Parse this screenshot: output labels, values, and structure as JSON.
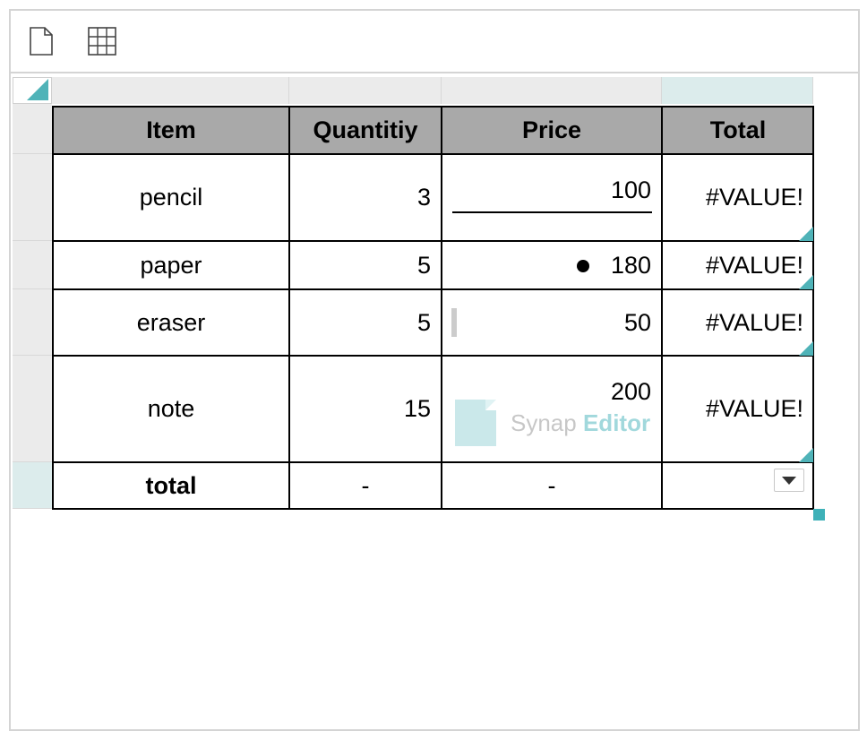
{
  "toolbar": {
    "new_doc_icon": "page-icon",
    "table_icon": "table-grid-icon"
  },
  "table": {
    "headers": [
      "Item",
      "Quantitiy",
      "Price",
      "Total"
    ],
    "rows": [
      {
        "item": "pencil",
        "qty": "3",
        "price": "100",
        "total": "#VALUE!"
      },
      {
        "item": "paper",
        "qty": "5",
        "price": "180",
        "total": "#VALUE!"
      },
      {
        "item": "eraser",
        "qty": "5",
        "price": "50",
        "total": "#VALUE!"
      },
      {
        "item": "note",
        "qty": "15",
        "price": "200",
        "total": "#VALUE!"
      }
    ],
    "footer": {
      "item": "total",
      "qty": "-",
      "price": "-",
      "total": ""
    }
  },
  "watermark": {
    "brand": "Synap",
    "product": "Editor"
  },
  "colors": {
    "accent": "#4fb3b8",
    "header_bg": "#a9a9a9",
    "selected_header": "#dcecec"
  }
}
